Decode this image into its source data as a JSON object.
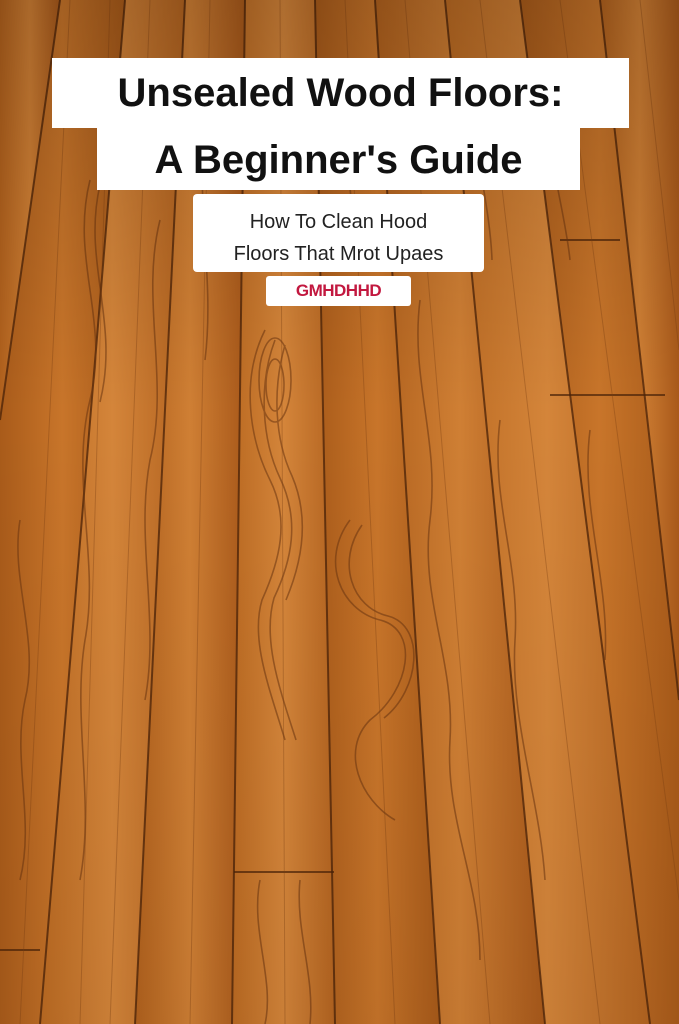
{
  "headline": {
    "line1": "Unsealed Wood Floors:",
    "line2": "A Beginner's Guide"
  },
  "subtitle": {
    "line1": "How To Clean Hood",
    "line2": "Floors That Mrot Upaes"
  },
  "badge": {
    "text": "GMHDHHD"
  },
  "colors": {
    "wood_base": "#b5651d",
    "wood_light": "#d7893a",
    "wood_dark": "#8e4a14",
    "grain": "#6b3510",
    "text_box": "#ffffff",
    "badge_text": "#c2183f"
  }
}
